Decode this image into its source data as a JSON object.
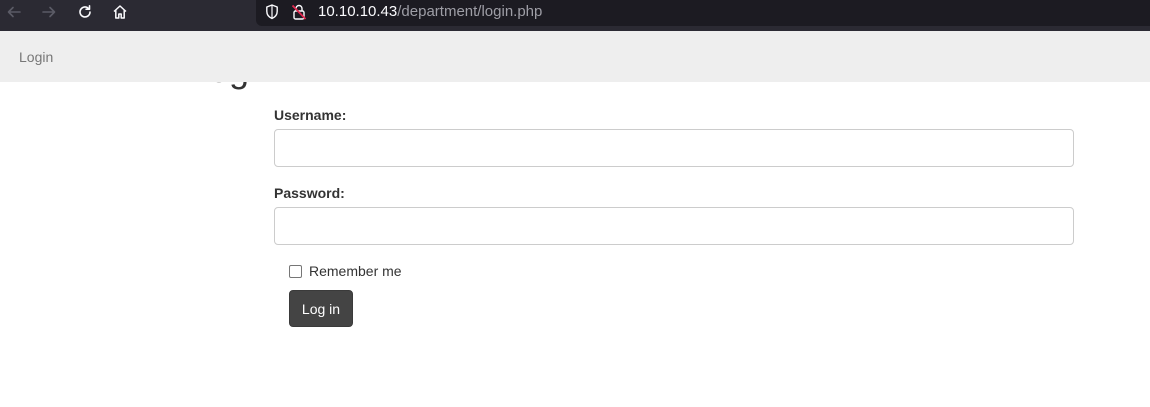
{
  "browser": {
    "back_icon": "arrow-left-icon",
    "forward_icon": "arrow-right-icon",
    "reload_icon": "reload-icon",
    "home_icon": "home-icon",
    "url_host": "10.10.10.43",
    "url_path": "/department/login.php"
  },
  "navbar": {
    "brand": "Login"
  },
  "page": {
    "heading": "Log in"
  },
  "form": {
    "username_label": "Username:",
    "username_value": "",
    "password_label": "Password:",
    "password_value": "",
    "remember_label": "Remember me",
    "remember_checked": false,
    "submit_label": "Log in"
  },
  "colors": {
    "browser_bar": "#2b2a33",
    "url_box": "#1c1b22",
    "navbar_bg": "#eeeeee",
    "button_bg": "#444444"
  }
}
